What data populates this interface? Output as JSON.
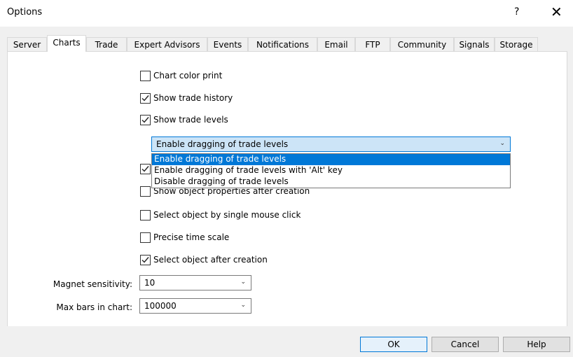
{
  "window": {
    "title": "Options",
    "help_glyph": "?",
    "close_glyph": "✕"
  },
  "tabs": [
    {
      "label": "Server"
    },
    {
      "label": "Charts"
    },
    {
      "label": "Trade"
    },
    {
      "label": "Expert Advisors"
    },
    {
      "label": "Events"
    },
    {
      "label": "Notifications"
    },
    {
      "label": "Email"
    },
    {
      "label": "FTP"
    },
    {
      "label": "Community"
    },
    {
      "label": "Signals"
    },
    {
      "label": "Storage"
    }
  ],
  "active_tab": "Charts",
  "options": {
    "chart_color_print": {
      "label": "Chart color print",
      "checked": false
    },
    "show_trade_history": {
      "label": "Show trade history",
      "checked": true
    },
    "show_trade_levels": {
      "label": "Show trade levels",
      "checked": true
    },
    "hidden_option": {
      "checked": true
    },
    "show_object_properties": {
      "label": "Show object properties after creation",
      "checked": false
    },
    "select_by_single_click": {
      "label": "Select object by single mouse click",
      "checked": false
    },
    "precise_time_scale": {
      "label": "Precise time scale",
      "checked": false
    },
    "select_after_creation": {
      "label": "Select object after creation",
      "checked": true
    }
  },
  "trade_levels_combo": {
    "value": "Enable dragging of trade levels",
    "options": [
      "Enable dragging of trade levels",
      "Enable dragging of trade levels with 'Alt' key",
      "Disable dragging of trade levels"
    ],
    "selected_index": 0,
    "expanded": true
  },
  "magnet_sensitivity": {
    "label": "Magnet sensitivity:",
    "value": "10"
  },
  "max_bars": {
    "label": "Max bars in chart:",
    "value": "100000"
  },
  "buttons": {
    "ok": "OK",
    "cancel": "Cancel",
    "help": "Help"
  },
  "colors": {
    "accent": "#0078d7",
    "selection_bg": "#cce4f7"
  }
}
